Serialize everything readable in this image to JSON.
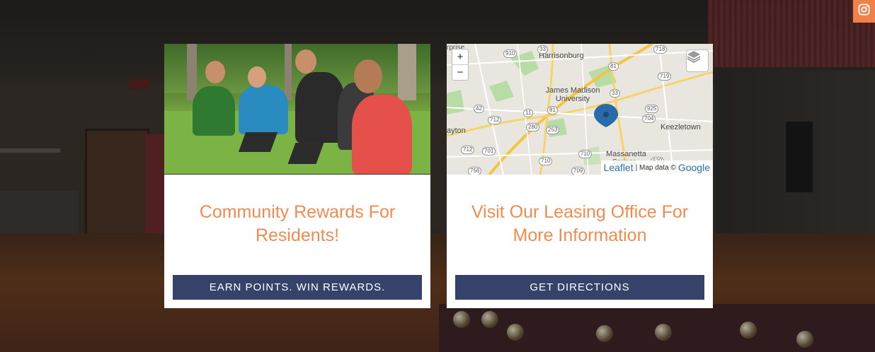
{
  "social": {
    "instagram_icon": "instagram-icon",
    "color": "#f08148"
  },
  "cards": [
    {
      "title": "Community Rewards For Residents!",
      "button_label": "EARN POINTS. WIN REWARDS."
    },
    {
      "title": "Visit Our Leasing Office For More Information",
      "button_label": "GET DIRECTIONS"
    }
  ],
  "map": {
    "zoom_in": "+",
    "zoom_out": "−",
    "layers_icon": "layers-icon",
    "marker_icon": "map-marker-icon",
    "attribution_leaflet": "Leaflet",
    "attribution_separator": "| Map data ©",
    "attribution_google": "Google",
    "labels": {
      "harrisonburg": "Harrisonburg",
      "jmu": "James Madison University",
      "keezletown": "Keezletown",
      "massanetta": "Massanetta",
      "dayton": "ayton",
      "prise": "rprise",
      "springs": "Springs"
    },
    "route_numbers": [
      "910",
      "33",
      "718",
      "81",
      "719",
      "42",
      "11",
      "81",
      "33",
      "925",
      "704",
      "712",
      "280",
      "712",
      "701",
      "253",
      "710",
      "620",
      "756",
      "710",
      "709",
      "33"
    ]
  },
  "colors": {
    "accent": "#f28b50",
    "button": "#35436b",
    "card": "#ffffff"
  }
}
